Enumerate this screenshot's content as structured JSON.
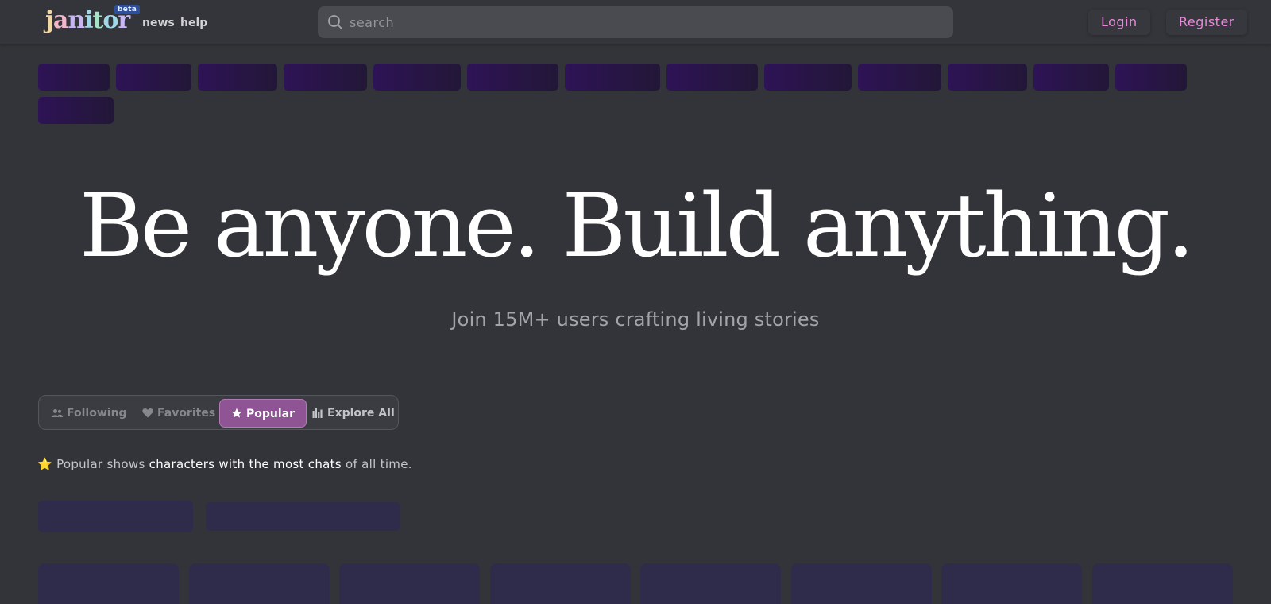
{
  "header": {
    "logo_text": "janitor",
    "beta_label": "beta",
    "nav": [
      {
        "label": "news"
      },
      {
        "label": "help"
      }
    ],
    "search_placeholder": "search",
    "login_label": "Login",
    "register_label": "Register"
  },
  "hero": {
    "title": "Be anyone. Build anything.",
    "subtitle": "Join 15M+ users crafting living stories"
  },
  "tabs": [
    {
      "label": "Following",
      "icon": "users-icon",
      "active": false
    },
    {
      "label": "Favorites",
      "icon": "heart-icon",
      "active": false
    },
    {
      "label": "Popular",
      "icon": "star-icon",
      "active": true
    },
    {
      "label": "Explore All",
      "icon": "bar-chart-icon",
      "active": false
    }
  ],
  "popular_note": {
    "emoji": "⭐",
    "prefix": "Popular shows",
    "emphasis": "characters with the most chats",
    "suffix": "of all time."
  },
  "colors": {
    "background": "#333439",
    "accent_pink": "#e58ad9",
    "active_tab": "#8e5494",
    "skeleton_tag": "#2e1356",
    "skeleton_card": "#2f2b4b"
  }
}
